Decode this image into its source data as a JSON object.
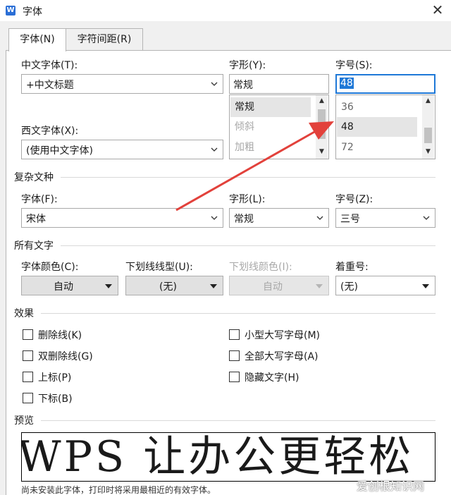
{
  "window": {
    "title": "字体",
    "app_icon": "wps-writer-icon",
    "close_icon": "close-icon"
  },
  "tabs": [
    {
      "label": "字体(N)",
      "active": true
    },
    {
      "label": "字符间距(R)",
      "active": false
    }
  ],
  "font_tab": {
    "chinese_font": {
      "label": "中文字体(T):",
      "value": "+中文标题"
    },
    "western_font": {
      "label": "西文字体(X):",
      "value": "(使用中文字体)"
    },
    "style": {
      "label": "字形(Y):",
      "value": "常规",
      "options": [
        {
          "text": "常规",
          "selected": true,
          "disabled": false
        },
        {
          "text": "倾斜",
          "selected": false,
          "disabled": true
        },
        {
          "text": "加粗",
          "selected": false,
          "disabled": true
        }
      ]
    },
    "size": {
      "label": "字号(S):",
      "value": "48",
      "options": [
        {
          "text": "36",
          "selected": false
        },
        {
          "text": "48",
          "selected": true
        },
        {
          "text": "72",
          "selected": false
        }
      ]
    },
    "complex_script": {
      "heading": "复杂文种",
      "font": {
        "label": "字体(F):",
        "value": "宋体"
      },
      "style": {
        "label": "字形(L):",
        "value": "常规"
      },
      "size": {
        "label": "字号(Z):",
        "value": "三号"
      }
    },
    "all_text": {
      "heading": "所有文字",
      "font_color": {
        "label": "字体颜色(C):",
        "value": "自动"
      },
      "underline_type": {
        "label": "下划线线型(U):",
        "value": "(无)"
      },
      "underline_color": {
        "label": "下划线颜色(I):",
        "value": "自动",
        "disabled": true
      },
      "emphasis": {
        "label": "着重号:",
        "value": "(无)"
      }
    },
    "effects": {
      "heading": "效果",
      "left": [
        {
          "label": "删除线(K)",
          "checked": false
        },
        {
          "label": "双删除线(G)",
          "checked": false
        },
        {
          "label": "上标(P)",
          "checked": false
        },
        {
          "label": "下标(B)",
          "checked": false
        }
      ],
      "right": [
        {
          "label": "小型大写字母(M)",
          "checked": false
        },
        {
          "label": "全部大写字母(A)",
          "checked": false
        },
        {
          "label": "隐藏文字(H)",
          "checked": false
        }
      ]
    },
    "preview": {
      "heading": "预览",
      "sample": "WPS 让办公更轻松",
      "note": "尚未安装此字体，打印时将采用最相近的有效字体。"
    }
  },
  "overlay": {
    "watermark": "爱创根知识网"
  },
  "colors": {
    "accent": "#1e78d7",
    "arrow": "#e2413b"
  }
}
